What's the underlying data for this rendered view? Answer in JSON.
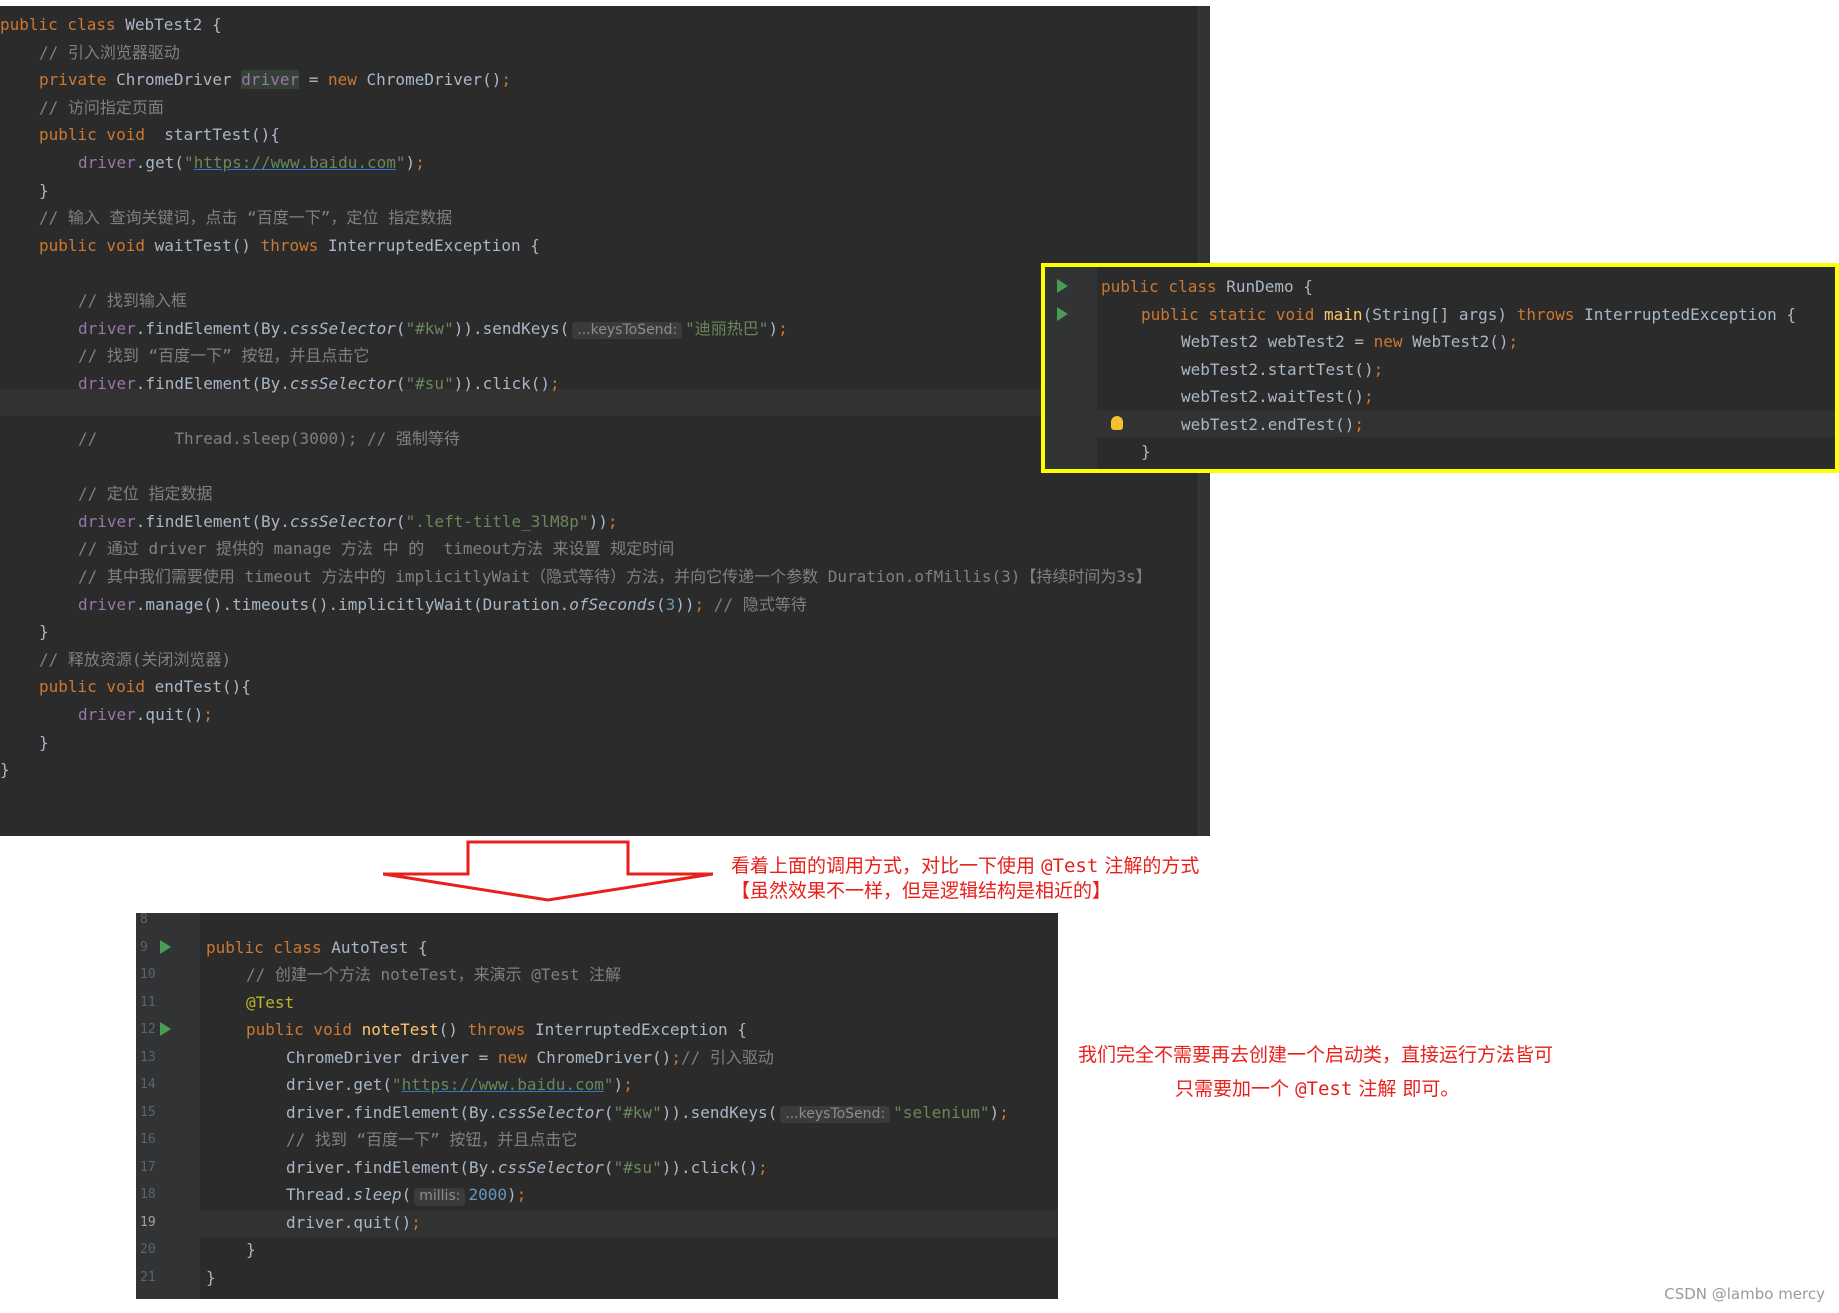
{
  "top_editor": {
    "lines": [
      {
        "indent": 0,
        "tokens": [
          {
            "t": "public class ",
            "c": "kw"
          },
          {
            "t": "WebTest2 ",
            "c": "cls"
          },
          {
            "t": "{",
            "c": ""
          }
        ]
      },
      {
        "indent": 1,
        "tokens": [
          {
            "t": "// 引入浏览器驱动",
            "c": "cm"
          }
        ]
      },
      {
        "indent": 1,
        "tokens": [
          {
            "t": "private ",
            "c": "kw"
          },
          {
            "t": "ChromeDriver ",
            "c": ""
          },
          {
            "t": "driver",
            "c": "fld hlvar"
          },
          {
            "t": " = ",
            "c": ""
          },
          {
            "t": "new ",
            "c": "kw"
          },
          {
            "t": "ChromeDriver()",
            "c": ""
          },
          {
            "t": ";",
            "c": "kw"
          }
        ]
      },
      {
        "indent": 1,
        "tokens": [
          {
            "t": "// 访问指定页面",
            "c": "cm"
          }
        ]
      },
      {
        "indent": 1,
        "tokens": [
          {
            "t": "public void  ",
            "c": "kw"
          },
          {
            "t": "startTest",
            "c": "cls"
          },
          {
            "t": "(){",
            "c": ""
          }
        ]
      },
      {
        "indent": 2,
        "tokens": [
          {
            "t": "driver",
            "c": "fld"
          },
          {
            "t": ".get(",
            "c": ""
          },
          {
            "t": "\"",
            "c": "st"
          },
          {
            "t": "https://www.baidu.com",
            "c": "url"
          },
          {
            "t": "\"",
            "c": "st"
          },
          {
            "t": ")",
            "c": ""
          },
          {
            "t": ";",
            "c": "kw"
          }
        ]
      },
      {
        "indent": 1,
        "tokens": [
          {
            "t": "}",
            "c": ""
          }
        ]
      },
      {
        "indent": 1,
        "tokens": [
          {
            "t": "// 输入 查询关键词，点击 “百度一下”，定位 指定数据",
            "c": "cm"
          }
        ]
      },
      {
        "indent": 1,
        "tokens": [
          {
            "t": "public void ",
            "c": "kw"
          },
          {
            "t": "waitTest",
            "c": "cls"
          },
          {
            "t": "() ",
            "c": ""
          },
          {
            "t": "throws ",
            "c": "kw"
          },
          {
            "t": "InterruptedException ",
            "c": "cls"
          },
          {
            "t": "{",
            "c": ""
          }
        ]
      },
      {
        "indent": 0,
        "tokens": []
      },
      {
        "indent": 2,
        "tokens": [
          {
            "t": "// 找到输入框",
            "c": "cm"
          }
        ]
      },
      {
        "indent": 2,
        "tokens": [
          {
            "t": "driver",
            "c": "fld"
          },
          {
            "t": ".findElement(By.",
            "c": ""
          },
          {
            "t": "cssSelector",
            "c": "ital"
          },
          {
            "t": "(",
            "c": ""
          },
          {
            "t": "\"#kw\"",
            "c": "st"
          },
          {
            "t": ")).sendKeys(",
            "c": ""
          },
          {
            "t": "...keysToSend:",
            "c": "hint"
          },
          {
            "t": "\"迪丽热巴\"",
            "c": "st"
          },
          {
            "t": ")",
            "c": ""
          },
          {
            "t": ";",
            "c": "kw"
          }
        ]
      },
      {
        "indent": 2,
        "tokens": [
          {
            "t": "// 找到 “百度一下” 按钮，并且点击它",
            "c": "cm"
          }
        ]
      },
      {
        "indent": 2,
        "tokens": [
          {
            "t": "driver",
            "c": "fld"
          },
          {
            "t": ".findElement(By.",
            "c": ""
          },
          {
            "t": "cssSelector",
            "c": "ital"
          },
          {
            "t": "(",
            "c": ""
          },
          {
            "t": "\"#su\"",
            "c": "st"
          },
          {
            "t": ")).click()",
            "c": ""
          },
          {
            "t": ";",
            "c": "kw"
          }
        ]
      },
      {
        "indent": 0,
        "tokens": []
      },
      {
        "indent": 2,
        "tokens": [
          {
            "t": "//        Thread.sleep(3000); // 强制等待",
            "c": "cm"
          }
        ]
      },
      {
        "indent": 0,
        "tokens": []
      },
      {
        "indent": 2,
        "tokens": [
          {
            "t": "// 定位 指定数据",
            "c": "cm"
          }
        ]
      },
      {
        "indent": 2,
        "tokens": [
          {
            "t": "driver",
            "c": "fld"
          },
          {
            "t": ".findElement(By.",
            "c": ""
          },
          {
            "t": "cssSelector",
            "c": "ital"
          },
          {
            "t": "(",
            "c": ""
          },
          {
            "t": "\".left-title_3lM8p\"",
            "c": "st"
          },
          {
            "t": "))",
            "c": ""
          },
          {
            "t": ";",
            "c": "kw"
          }
        ]
      },
      {
        "indent": 2,
        "tokens": [
          {
            "t": "// 通过 driver 提供的 manage 方法 中 的  timeout方法 来设置 规定时间",
            "c": "cm"
          }
        ]
      },
      {
        "indent": 2,
        "tokens": [
          {
            "t": "// 其中我们需要使用 timeout 方法中的 implicitlyWait（隐式等待）方法，并向它传递一个参数 Duration.ofMillis(3)【持续时间为3s】",
            "c": "cm"
          }
        ]
      },
      {
        "indent": 2,
        "tokens": [
          {
            "t": "driver",
            "c": "fld"
          },
          {
            "t": ".manage().timeouts().implicitlyWait(Duration.",
            "c": ""
          },
          {
            "t": "ofSeconds",
            "c": "ital"
          },
          {
            "t": "(",
            "c": ""
          },
          {
            "t": "3",
            "c": "nm"
          },
          {
            "t": "))",
            "c": ""
          },
          {
            "t": "; ",
            "c": "kw"
          },
          {
            "t": "// 隐式等待",
            "c": "cm"
          }
        ]
      },
      {
        "indent": 1,
        "tokens": [
          {
            "t": "}",
            "c": ""
          }
        ]
      },
      {
        "indent": 1,
        "tokens": [
          {
            "t": "// 释放资源(关闭浏览器)",
            "c": "cm"
          }
        ]
      },
      {
        "indent": 1,
        "tokens": [
          {
            "t": "public void ",
            "c": "kw"
          },
          {
            "t": "endTest",
            "c": "cls"
          },
          {
            "t": "(){",
            "c": ""
          }
        ]
      },
      {
        "indent": 2,
        "tokens": [
          {
            "t": "driver",
            "c": "fld"
          },
          {
            "t": ".quit()",
            "c": ""
          },
          {
            "t": ";",
            "c": "kw"
          }
        ]
      },
      {
        "indent": 1,
        "tokens": [
          {
            "t": "}",
            "c": ""
          }
        ]
      },
      {
        "indent": 0,
        "tokens": [
          {
            "t": "}",
            "c": ""
          }
        ]
      }
    ]
  },
  "run_demo": {
    "lines": [
      {
        "indent": 0,
        "run": true,
        "tokens": [
          {
            "t": "public class ",
            "c": "kw"
          },
          {
            "t": "RunDemo ",
            "c": ""
          },
          {
            "t": "{",
            "c": ""
          }
        ]
      },
      {
        "indent": 1,
        "run": true,
        "tokens": [
          {
            "t": "public static void ",
            "c": "kw"
          },
          {
            "t": "main",
            "c": "fn"
          },
          {
            "t": "(String[] args) ",
            "c": ""
          },
          {
            "t": "throws ",
            "c": "kw"
          },
          {
            "t": "InterruptedException {",
            "c": ""
          }
        ]
      },
      {
        "indent": 2,
        "tokens": [
          {
            "t": "WebTest2 webTest2 = ",
            "c": ""
          },
          {
            "t": "new ",
            "c": "kw"
          },
          {
            "t": "WebTest2()",
            "c": ""
          },
          {
            "t": ";",
            "c": "kw"
          }
        ]
      },
      {
        "indent": 2,
        "tokens": [
          {
            "t": "webTest2.startTest()",
            "c": ""
          },
          {
            "t": ";",
            "c": "kw"
          }
        ]
      },
      {
        "indent": 2,
        "tokens": [
          {
            "t": "webTest2.waitTest()",
            "c": ""
          },
          {
            "t": ";",
            "c": "kw"
          }
        ]
      },
      {
        "indent": 2,
        "bulb": true,
        "tokens": [
          {
            "t": "webTest2.endTest()",
            "c": ""
          },
          {
            "t": ";",
            "c": "kw"
          }
        ]
      },
      {
        "indent": 1,
        "tokens": [
          {
            "t": "}",
            "c": ""
          }
        ]
      }
    ]
  },
  "auto_test": {
    "lines": [
      {
        "num": "8",
        "tokens": []
      },
      {
        "num": "9",
        "run": true,
        "tokens": [
          {
            "t": "public class ",
            "c": "kw"
          },
          {
            "t": "AutoTest ",
            "c": ""
          },
          {
            "t": "{",
            "c": ""
          }
        ]
      },
      {
        "num": "10",
        "indent": 1,
        "tokens": [
          {
            "t": "// 创建一个方法 noteTest，来演示 @Test 注解",
            "c": "cm"
          }
        ]
      },
      {
        "num": "11",
        "indent": 1,
        "tokens": [
          {
            "t": "@Test",
            "c": "an"
          }
        ]
      },
      {
        "num": "12",
        "indent": 1,
        "run": true,
        "tokens": [
          {
            "t": "public void ",
            "c": "kw"
          },
          {
            "t": "noteTest",
            "c": "fn"
          },
          {
            "t": "() ",
            "c": ""
          },
          {
            "t": "throws ",
            "c": "kw"
          },
          {
            "t": "InterruptedException {",
            "c": ""
          }
        ]
      },
      {
        "num": "13",
        "indent": 2,
        "tokens": [
          {
            "t": "ChromeDriver driver = ",
            "c": ""
          },
          {
            "t": "new ",
            "c": "kw"
          },
          {
            "t": "ChromeDriver()",
            "c": ""
          },
          {
            "t": ";",
            "c": "kw"
          },
          {
            "t": "// 引入驱动",
            "c": "cm"
          }
        ]
      },
      {
        "num": "14",
        "indent": 2,
        "tokens": [
          {
            "t": "driver.get(",
            "c": ""
          },
          {
            "t": "\"",
            "c": "st"
          },
          {
            "t": "https://www.baidu.com",
            "c": "url"
          },
          {
            "t": "\"",
            "c": "st"
          },
          {
            "t": ")",
            "c": ""
          },
          {
            "t": ";",
            "c": "kw"
          }
        ]
      },
      {
        "num": "15",
        "indent": 2,
        "tokens": [
          {
            "t": "driver.findElement(By.",
            "c": ""
          },
          {
            "t": "cssSelector",
            "c": "ital"
          },
          {
            "t": "(",
            "c": ""
          },
          {
            "t": "\"#kw\"",
            "c": "st"
          },
          {
            "t": ")).sendKeys(",
            "c": ""
          },
          {
            "t": "...keysToSend:",
            "c": "hint"
          },
          {
            "t": "\"selenium\"",
            "c": "st"
          },
          {
            "t": ")",
            "c": ""
          },
          {
            "t": ";",
            "c": "kw"
          }
        ]
      },
      {
        "num": "16",
        "indent": 2,
        "tokens": [
          {
            "t": "// 找到 “百度一下” 按钮，并且点击它",
            "c": "cm"
          }
        ]
      },
      {
        "num": "17",
        "indent": 2,
        "tokens": [
          {
            "t": "driver.findElement(By.",
            "c": ""
          },
          {
            "t": "cssSelector",
            "c": "ital"
          },
          {
            "t": "(",
            "c": ""
          },
          {
            "t": "\"#su\"",
            "c": "st"
          },
          {
            "t": ")).click()",
            "c": ""
          },
          {
            "t": ";",
            "c": "kw"
          }
        ]
      },
      {
        "num": "18",
        "indent": 2,
        "tokens": [
          {
            "t": "Thread.",
            "c": ""
          },
          {
            "t": "sleep",
            "c": "ital"
          },
          {
            "t": "(",
            "c": ""
          },
          {
            "t": "millis:",
            "c": "hint"
          },
          {
            "t": "2000",
            "c": "nm"
          },
          {
            "t": ")",
            "c": ""
          },
          {
            "t": ";",
            "c": "kw"
          }
        ]
      },
      {
        "num": "19",
        "indent": 2,
        "current": true,
        "tokens": [
          {
            "t": "driver.quit()",
            "c": ""
          },
          {
            "t": ";",
            "c": "kw"
          }
        ]
      },
      {
        "num": "20",
        "indent": 1,
        "tokens": [
          {
            "t": "}",
            "c": ""
          }
        ]
      },
      {
        "num": "21",
        "indent": 0,
        "tokens": [
          {
            "t": "}",
            "c": ""
          }
        ]
      }
    ]
  },
  "annotations": {
    "arrow_note_line1": "看着上面的调用方式，对比一下使用",
    "arrow_note_code": "@Test",
    "arrow_note_line1_tail": "注解的方式",
    "arrow_note_line2": "【虽然效果不一样，但是逻辑结构是相近的】",
    "right_note_line1": "我们完全不需要再去创建一个启动类，直接运行方法皆可",
    "right_note_line2_a": "只需要加一个",
    "right_note_code": "@Test",
    "right_note_line2_b": "注解 即可。",
    "watermark": "CSDN @lambo mercy"
  },
  "colors": {
    "editor_bg": "#2b2b2b",
    "highlight_border": "#ffff00",
    "annotation_red": "#e8201c",
    "run_icon": "#499c54"
  }
}
